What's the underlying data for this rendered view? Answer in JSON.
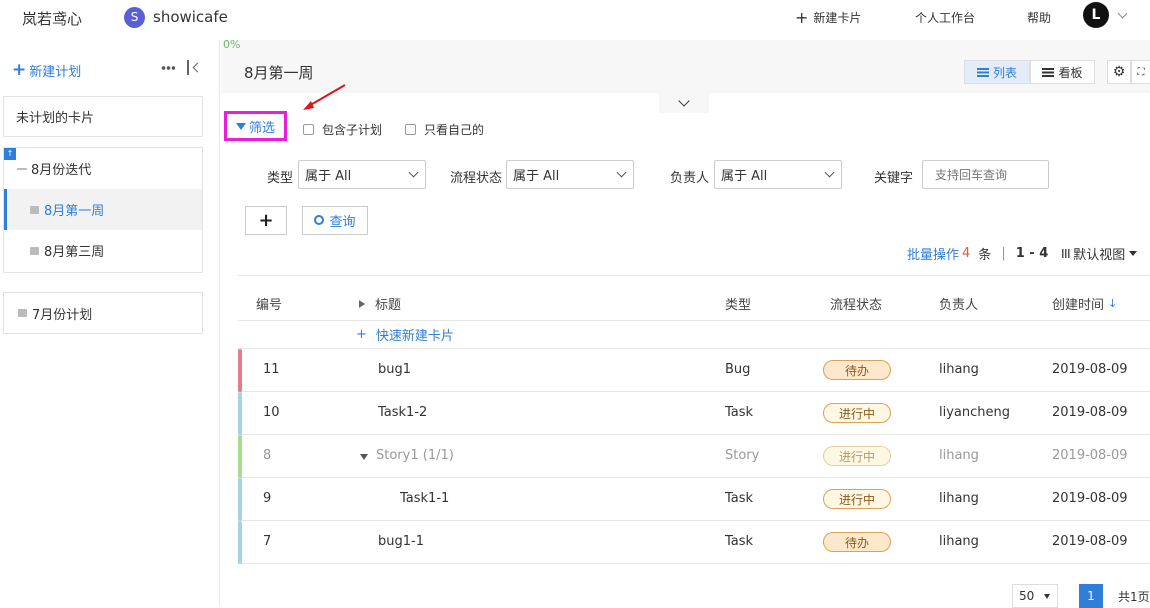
{
  "top": {
    "brand": "岚若鸢心",
    "project_initial": "S",
    "project_name": "showicafe",
    "new_card": "新建卡片",
    "workspace": "个人工作台",
    "help": "帮助",
    "avatar": "L"
  },
  "sidebar": {
    "new_plan": "新建计划",
    "unplanned": "未计划的卡片",
    "iteration": "8月份迭代",
    "week1": "8月第一周",
    "week3": "8月第三周",
    "july": "7月份计划"
  },
  "main": {
    "progress": "0%",
    "title": "8月第一周",
    "view_list": "列表",
    "view_board": "看板",
    "filter": "筛选",
    "include_sub": "包含子计划",
    "only_mine": "只看自己的",
    "type_label": "类型",
    "status_label": "流程状态",
    "owner_label": "负责人",
    "keyword_label": "关键字",
    "type_value": "属于 All",
    "status_value": "属于 All",
    "owner_value": "属于 All",
    "keyword_placeholder": "支持回车查询",
    "query": "查询",
    "batch_ops": "批量操作",
    "count": "4",
    "count_unit": "条",
    "range": "1 - 4",
    "default_view": "默认视图",
    "quick_new": "快速新建卡片",
    "page_size": "50",
    "page_current": "1",
    "page_total": "共1页"
  },
  "columns": {
    "id": "编号",
    "title": "标题",
    "type": "类型",
    "status": "流程状态",
    "owner": "负责人",
    "created": "创建时间"
  },
  "rows": [
    {
      "id": "11",
      "title": "bug1",
      "type": "Bug",
      "status": "待办",
      "owner": "lihang",
      "created": "2019-08-09",
      "color": "#e57d86"
    },
    {
      "id": "10",
      "title": "Task1-2",
      "type": "Task",
      "status": "进行中",
      "owner": "liyancheng",
      "created": "2019-08-09",
      "color": "#a9d0ea"
    },
    {
      "id": "8",
      "title": "Story1 (1/1)",
      "type": "Story",
      "status": "进行中",
      "owner": "lihang",
      "created": "2019-08-09",
      "color": "#a7dd8f"
    },
    {
      "id": "9",
      "title": "Task1-1",
      "type": "Task",
      "status": "进行中",
      "owner": "lihang",
      "created": "2019-08-09",
      "color": "#a9d0ea"
    },
    {
      "id": "7",
      "title": "bug1-1",
      "type": "Task",
      "status": "待办",
      "owner": "lihang",
      "created": "2019-08-09",
      "color": "#a9d0ea"
    }
  ],
  "colors": {
    "accent": "#2f7ed8",
    "highlight": "#e81ed8",
    "arrow": "#e0141e"
  }
}
